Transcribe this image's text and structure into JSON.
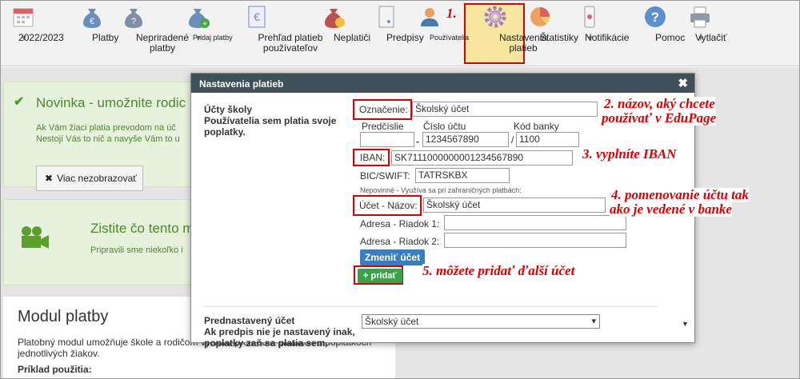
{
  "toolbar": {
    "items": [
      {
        "label": "2022/2023",
        "icon": "calendar-icon"
      },
      {
        "label": "Platby",
        "icon": "money-bag-icon"
      },
      {
        "label": "Nepriradené platby",
        "icon": "money-bag-question-icon"
      },
      {
        "label": "Pridaj platby",
        "icon": "money-bag-add-icon"
      },
      {
        "label": "Prehľad platieb používateľov",
        "icon": "euro-document-icon"
      },
      {
        "label": "Neplatiči",
        "icon": "money-bag-clock-icon"
      },
      {
        "label": "Predpisy",
        "icon": "document-icon"
      },
      {
        "label": "Používatelia",
        "icon": "user-icon"
      },
      {
        "label": "Nastavenia platieb",
        "icon": "gear-icon"
      },
      {
        "label": "Štatistiky",
        "icon": "pie-chart-icon"
      },
      {
        "label": "Notifikácie",
        "icon": "phone-icon"
      },
      {
        "label": "Pomoc",
        "icon": "help-icon"
      },
      {
        "label": "Vytlačiť",
        "icon": "printer-icon"
      }
    ],
    "annotation": "1."
  },
  "cards": {
    "news_title": "Novinka - umožnite rodic",
    "news_line1": "Ak Vám žiaci platia prevodom na úč",
    "news_line2": "Nestojí Vás to nič a navyše Vám to u",
    "news_button": "Viac nezobrazovať",
    "video_title": "Zistite čo tento m",
    "video_text": "Pripravili sme niekoľko i"
  },
  "modul": {
    "heading": "Modul platby",
    "paragraph": "Platobný modul umožňuje škole a rodičom vytvoriť prehľad o platbách a poplatkoch jednotlivých žiakov.",
    "example": "Príklad použitia:"
  },
  "modal": {
    "title": "Nastavenia platieb",
    "accounts_title": "Účty školy",
    "accounts_desc": "Používatelia sem platia svoje poplatky.",
    "label_designation": "Označenie:",
    "designation_value": "Školský účet",
    "label_prefix": "Predčíslie",
    "label_account": "Číslo účtu",
    "label_bank": "Kód banky",
    "prefix_value": "",
    "account_value": "1234567890",
    "bank_value": "1100",
    "dash": "-",
    "slash": "/",
    "label_iban": "IBAN:",
    "iban_value": "SK7111000000001234567890",
    "label_bic": "BIC/SWIFT:",
    "bic_value": "TATRSKBX",
    "optional_note": "Nepovinné - Využíva sa pri zahraničných platbách:",
    "label_account_name": "Účet - Názov:",
    "account_name_value": "Školský účet",
    "label_address1": "Adresa - Riadok 1:",
    "label_address2": "Adresa - Riadok 2:",
    "address1_value": "",
    "address2_value": "",
    "change_button": "Zmeniť účet",
    "add_button": "+ pridať",
    "default_title": "Prednastavený účet",
    "default_desc": "Ak predpis nie je nastavený inak, poplatky zaň sa platia sem.",
    "default_select": "Školský účet"
  },
  "annotations": {
    "a2": "2. názov, aký chcete",
    "a2b": "používať v EduPage",
    "a3": "3. vyplníte IBAN",
    "a4": "4. pomenovanie účtu tak",
    "a4b": "ako je vedené v banke",
    "a5": "5. môžete pridať ďalší účet"
  },
  "colors": {
    "accent_red": "#dd0000",
    "modal_header": "#40505a",
    "green_text": "#4a8a2a"
  }
}
